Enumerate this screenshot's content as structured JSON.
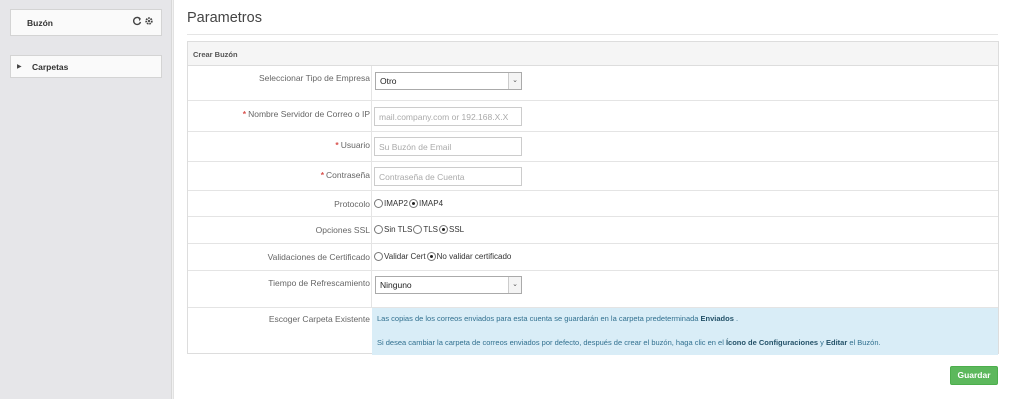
{
  "sidebar": {
    "buzon_label": "Buzón",
    "buzon_icons": [
      "refresh-icon",
      "gear-icon"
    ],
    "carpetas_label": "Carpetas"
  },
  "page": {
    "title": "Parametros"
  },
  "form": {
    "panel_title": "Crear Buzón",
    "empresa": {
      "label": "Seleccionar Tipo de Empresa",
      "value": "Otro"
    },
    "servidor": {
      "label": "Nombre Servidor de Correo o IP",
      "required": "*",
      "placeholder": "mail.company.com or 192.168.X.X"
    },
    "usuario": {
      "label": "Usuario",
      "required": "*",
      "placeholder": "Su Buzón de Email"
    },
    "contrasena": {
      "label": "Contraseña",
      "required": "*",
      "placeholder": "Contraseña de Cuenta"
    },
    "protocolo": {
      "label": "Protocolo",
      "options": [
        "IMAP2",
        "IMAP4"
      ],
      "selected": "IMAP4"
    },
    "ssl": {
      "label": "Opciones SSL",
      "options": [
        "Sin TLS",
        "TLS",
        "SSL"
      ],
      "selected": "SSL"
    },
    "certificado": {
      "label": "Validaciones de Certificado",
      "options": [
        "Validar Cert",
        "No validar certificado"
      ],
      "selected": "No validar certificado"
    },
    "refresco": {
      "label": "Tiempo de Refrescamiento",
      "value": "Ninguno"
    },
    "carpeta": {
      "label": "Escoger Carpeta Existente",
      "line1_a": "Las copias de los correos enviados para esta cuenta se guardarán en la carpeta predeterminada ",
      "line1_b": "Enviados",
      "line1_c": " .",
      "line2_a": "Si desea cambiar la carpeta de correos enviados por defecto, después de crear el buzón, haga clic en el ",
      "line2_b": "Ícono de Configuraciones",
      "line2_c": " y ",
      "line2_d": "Editar",
      "line2_e": " el Buzón."
    }
  },
  "actions": {
    "save_label": "Guardar"
  },
  "colors": {
    "save_button": "#5cb85c",
    "info_background": "#d9edf7",
    "required": "#d9534f"
  }
}
